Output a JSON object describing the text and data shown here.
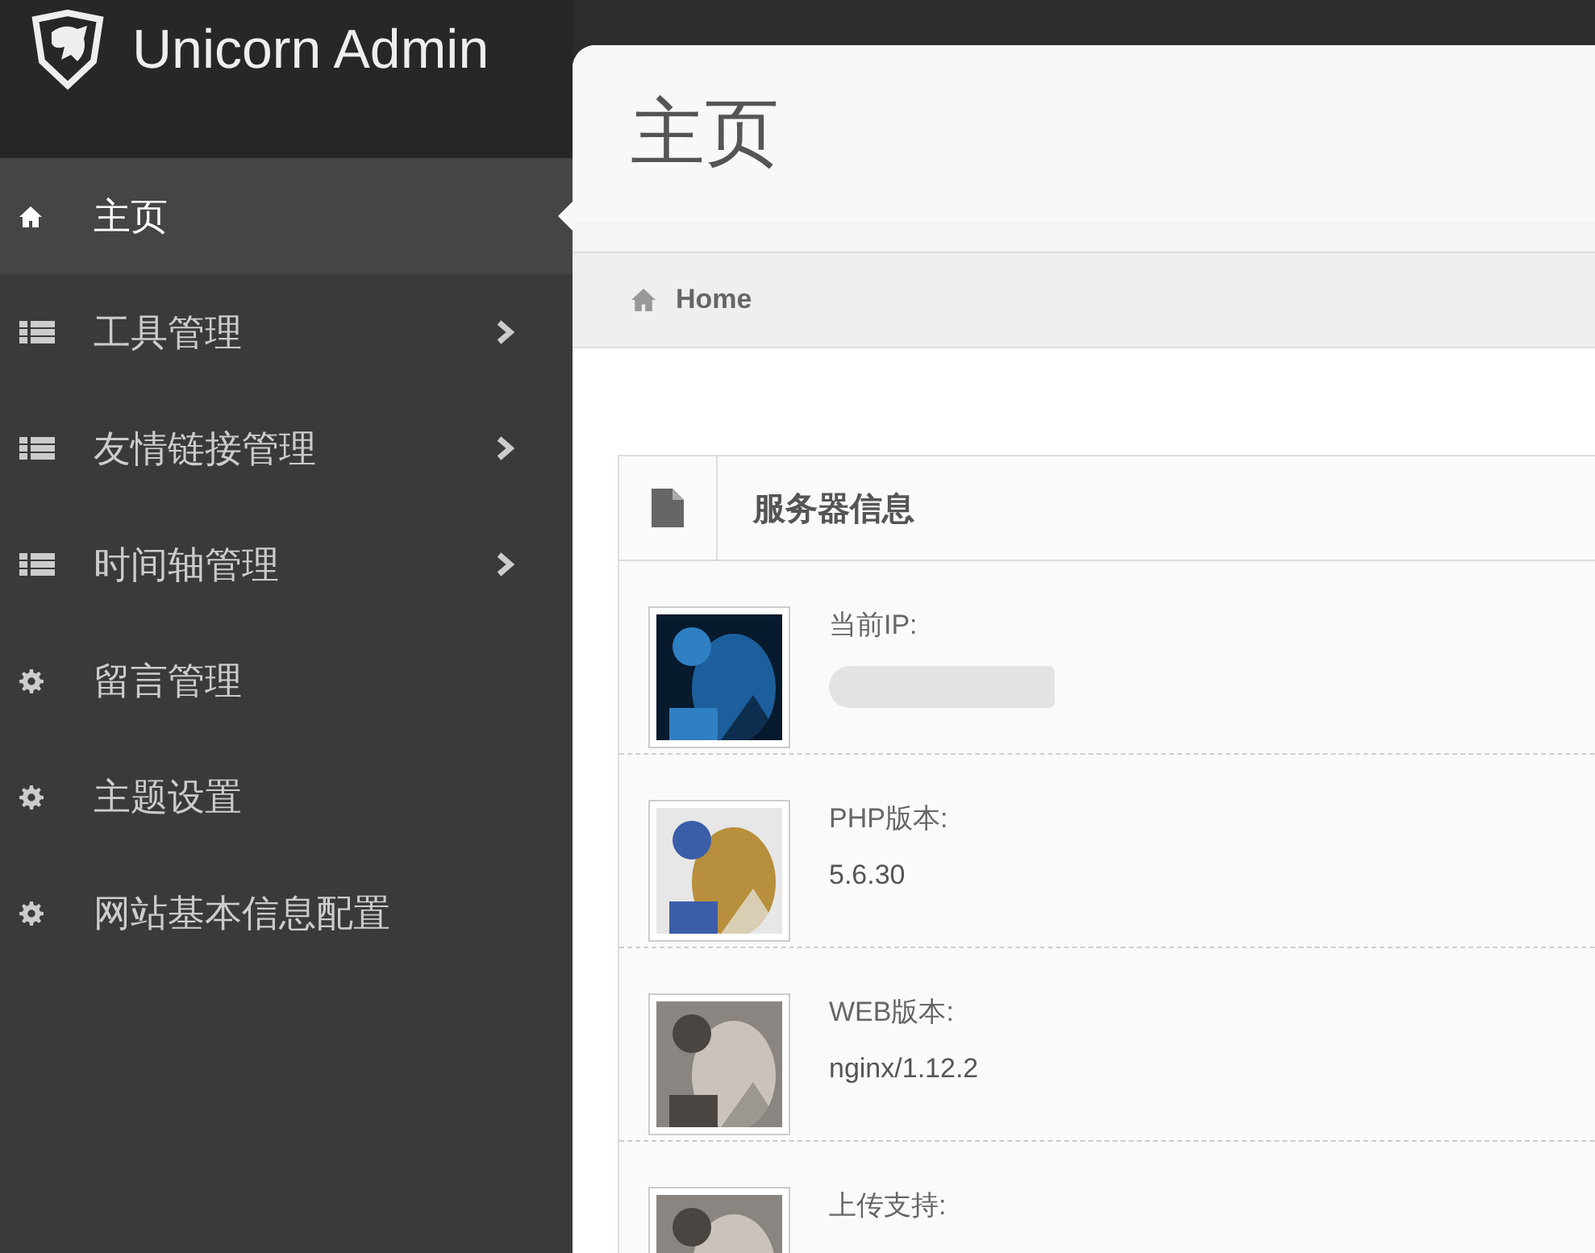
{
  "brand": {
    "title": "Unicorn Admin"
  },
  "sidebar": {
    "items": [
      {
        "label": "主页",
        "kind": "home",
        "selected": true,
        "submenu": false
      },
      {
        "label": "工具管理",
        "kind": "list",
        "selected": false,
        "submenu": true
      },
      {
        "label": "友情链接管理",
        "kind": "list",
        "selected": false,
        "submenu": true
      },
      {
        "label": "时间轴管理",
        "kind": "list",
        "selected": false,
        "submenu": true
      },
      {
        "label": "留言管理",
        "kind": "gear",
        "selected": false,
        "submenu": false
      },
      {
        "label": "主题设置",
        "kind": "gear",
        "selected": false,
        "submenu": false
      },
      {
        "label": "网站基本信息配置",
        "kind": "gear",
        "selected": false,
        "submenu": false
      }
    ]
  },
  "page": {
    "title": "主页"
  },
  "breadcrumb": [
    {
      "label": "Home"
    }
  ],
  "widget": {
    "title": "服务器信息",
    "rows": [
      {
        "label": "当前IP:",
        "redacted": true
      },
      {
        "label": "PHP版本:",
        "value": "5.6.30"
      },
      {
        "label": "WEB版本:",
        "value": "nginx/1.12.2"
      },
      {
        "label": "上传支持:"
      }
    ]
  }
}
